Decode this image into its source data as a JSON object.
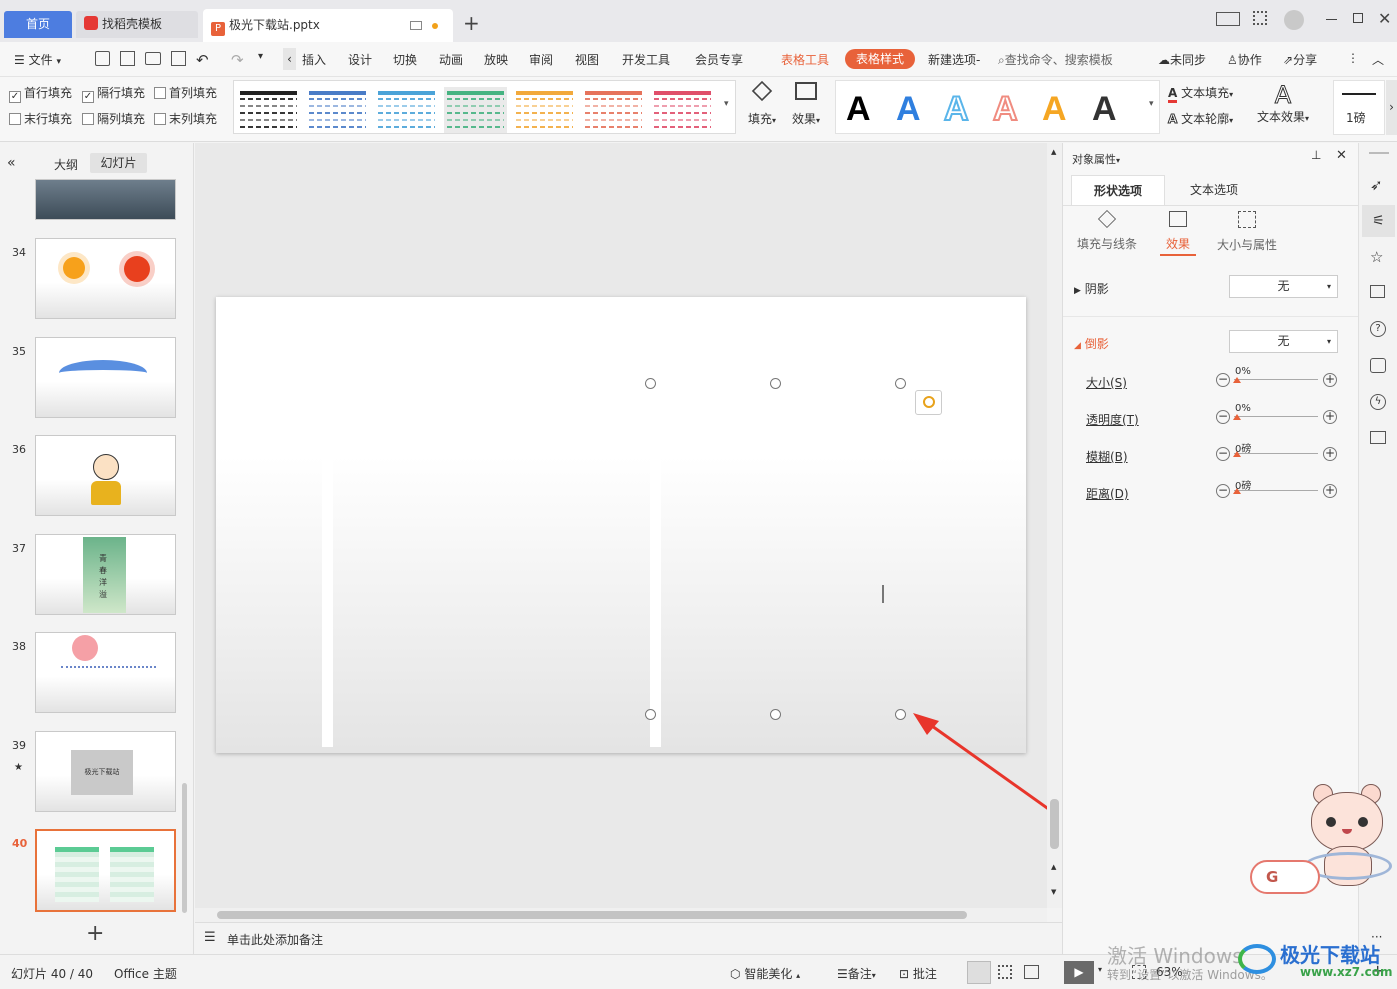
{
  "tabs": {
    "home": "首页",
    "template": "找稻壳模板",
    "file": "极光下载站.pptx"
  },
  "menu": {
    "file": "文件",
    "insert": "插入",
    "design": "设计",
    "transition": "切换",
    "animation": "动画",
    "slideshow": "放映",
    "review": "审阅",
    "view": "视图",
    "devtools": "开发工具",
    "member": "会员专享",
    "table_tools": "表格工具",
    "table_style": "表格样式",
    "new_tab": "新建选项",
    "search": "查找命令、搜索模板",
    "unsynced": "未同步",
    "collab": "协作",
    "share": "分享"
  },
  "ribbon": {
    "checkboxes": [
      {
        "label": "首行填充",
        "checked": true
      },
      {
        "label": "隔行填充",
        "checked": true
      },
      {
        "label": "首列填充",
        "checked": false
      },
      {
        "label": "末行填充",
        "checked": false
      },
      {
        "label": "隔列填充",
        "checked": false
      },
      {
        "label": "末列填充",
        "checked": false
      }
    ],
    "style_colors": [
      "#222222",
      "#4a7cc7",
      "#4ba3d8",
      "#45b381",
      "#f2a93b",
      "#e6735c",
      "#e04f6b"
    ],
    "fill": "填充",
    "effect": "效果",
    "text_colors": [
      "#000000",
      "#2f7fdf",
      "#5ab5ea",
      "#f08c80",
      "#f5a623",
      "#333333"
    ],
    "text_fill": "文本填充",
    "text_outline": "文本轮廓",
    "text_effect": "文本效果",
    "line_weight": "1磅"
  },
  "left": {
    "outline_tab": "大纲",
    "slides_tab": "幻灯片",
    "slide_numbers": [
      "34",
      "35",
      "36",
      "37",
      "38",
      "39",
      "40"
    ],
    "slide37_text": "青春洋溢",
    "slide39_text": "极光下载站",
    "add": "+"
  },
  "notes": "单击此处添加备注",
  "panel": {
    "title": "对象属性",
    "tab_shape": "形状选项",
    "tab_text": "文本选项",
    "sub_fill": "填充与线条",
    "sub_effect": "效果",
    "sub_size": "大小与属性",
    "shadow": "阴影",
    "shadow_value": "无",
    "reflection": "倒影",
    "reflection_value": "无",
    "rows": [
      {
        "label": "大小(S)",
        "value": "0%",
        "level": 0
      },
      {
        "label": "透明度(T)",
        "value": "0%",
        "level": 0
      },
      {
        "label": "模糊(B)",
        "value": "0磅",
        "level": 0
      },
      {
        "label": "距离(D)",
        "value": "0磅",
        "level": 0
      }
    ]
  },
  "status": {
    "slide": "幻灯片 40 / 40",
    "theme": "Office 主题",
    "beautify": "智能美化",
    "notes": "备注",
    "comment": "批注",
    "zoom": "63%"
  },
  "watermark": {
    "activate": "激活 Windows",
    "activate_sub": "转到“设置”以激活 Windows。",
    "brand": "极光下载站",
    "url": "www.xz7.com"
  },
  "colors": {
    "accent": "#e8623a",
    "header_green": "#5bcb94",
    "row_dark": "#d3ebdf",
    "row_light": "#e8f5ee"
  }
}
